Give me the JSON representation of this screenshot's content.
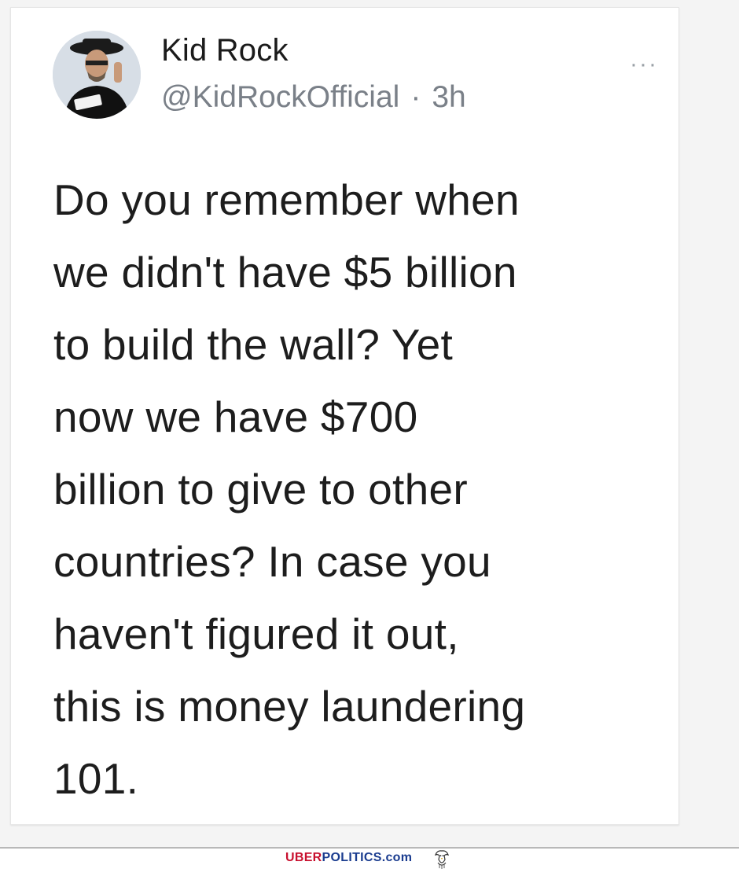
{
  "tweet": {
    "display_name": "Kid Rock",
    "handle": "@KidRockOfficial",
    "separator": "·",
    "time": "3h",
    "more_label": "···",
    "avatar_icon": "user-avatar-icon",
    "body_lines": [
      "Do you remember when",
      "we didn't have $5 billion",
      "to build the wall? Yet",
      "now we have $700",
      "billion to give to other",
      "countries? In case you",
      "haven't figured it out,",
      "this is money laundering",
      "101."
    ]
  },
  "watermark": {
    "part1": "UBER",
    "part2": "POLITICS.com",
    "part1_color": "#c8102e",
    "part2_color": "#1a3c8f",
    "logo_icon": "eagle-icon"
  }
}
